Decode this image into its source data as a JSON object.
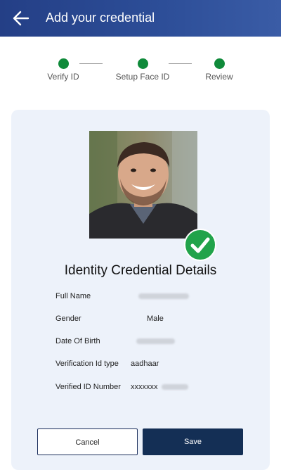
{
  "appbar": {
    "title": "Add your credential"
  },
  "steps": [
    {
      "label": "Verify ID"
    },
    {
      "label": "Setup Face ID"
    },
    {
      "label": "Review"
    }
  ],
  "details": {
    "title": "Identity Credential Details",
    "rows": [
      {
        "label": "Full Name",
        "value": ""
      },
      {
        "label": "Gender",
        "value": "Male"
      },
      {
        "label": "Date Of Birth",
        "value": ""
      },
      {
        "label": "Verification Id type",
        "value": "aadhaar"
      },
      {
        "label": "Verified ID Number",
        "value": "xxxxxxx"
      }
    ]
  },
  "buttons": {
    "cancel": "Cancel",
    "save": "Save"
  },
  "colors": {
    "appbar": "#243f86",
    "step_done": "#0f8a3a",
    "save": "#142f55",
    "card": "#edf2fa",
    "badge": "#21a34a"
  },
  "icons": {
    "back": "arrow-left-icon",
    "verified": "check-circle-icon"
  }
}
